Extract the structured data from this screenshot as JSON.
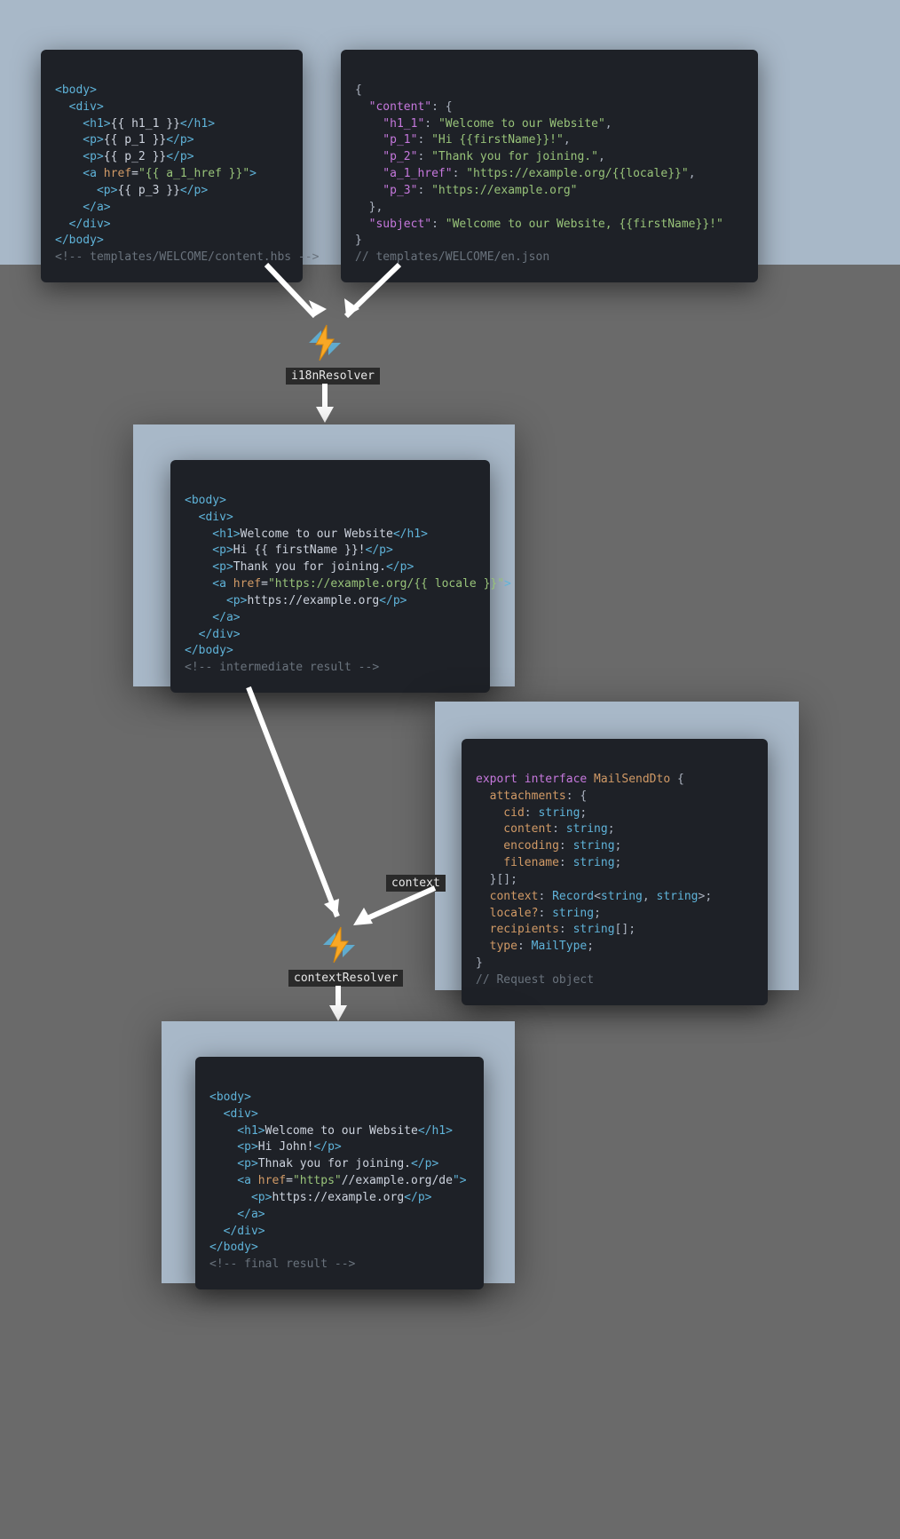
{
  "labels": {
    "i18nResolver": "i18nResolver",
    "contextResolver": "contextResolver",
    "context": "context"
  },
  "code": {
    "box1": {
      "l1a": "<body>",
      "l2a": "  <div>",
      "l3a": "    <h1>",
      "l3b": "{{ h1_1 }}",
      "l3c": "</h1>",
      "l4a": "    <p>",
      "l4b": "{{ p_1 }}",
      "l4c": "</p>",
      "l5a": "    <p>",
      "l5b": "{{ p_2 }}",
      "l5c": "</p>",
      "l6a": "    <a ",
      "l6b": "href",
      "l6c": "=",
      "l6d": "\"{{ a_1_href }}\"",
      "l6e": ">",
      "l7a": "      <p>",
      "l7b": "{{ p_3 }}",
      "l7c": "</p>",
      "l8a": "    </a>",
      "l9a": "  </div>",
      "l10a": "</body>",
      "l11a": "<!-- templates/WELCOME/content.hbs -->"
    },
    "box2": {
      "l1": "{",
      "l2a": "  \"content\"",
      "l2b": ": {",
      "l3a": "    \"h1_1\"",
      "l3b": ": ",
      "l3c": "\"Welcome to our Website\"",
      "l3d": ",",
      "l4a": "    \"p_1\"",
      "l4b": ": ",
      "l4c": "\"Hi {{firstName}}!\"",
      "l4d": ",",
      "l5a": "    \"p_2\"",
      "l5b": ": ",
      "l5c": "\"Thank you for joining.\"",
      "l5d": ",",
      "l6a": "    \"a_1_href\"",
      "l6b": ": ",
      "l6c": "\"https://example.org/{{locale}}\"",
      "l6d": ",",
      "l7a": "    \"p_3\"",
      "l7b": ": ",
      "l7c": "\"https://example.org\"",
      "l8": "  },",
      "l9a": "  \"subject\"",
      "l9b": ": ",
      "l9c": "\"Welcome to our Website, {{firstName}}!\"",
      "l10": "}",
      "l11": "// templates/WELCOME/en.json"
    },
    "box3": {
      "l1": "<body>",
      "l2": "  <div>",
      "l3a": "    <h1>",
      "l3b": "Welcome to our Website",
      "l3c": "</h1>",
      "l4a": "    <p>",
      "l4b": "Hi {{ firstName }}!",
      "l4c": "</p>",
      "l5a": "    <p>",
      "l5b": "Thank you for joining.",
      "l5c": "</p>",
      "l6a": "    <a ",
      "l6b": "href",
      "l6c": "=",
      "l6d": "\"https://example.org/{{ locale }}\"",
      "l6e": ">",
      "l7a": "      <p>",
      "l7b": "https://example.org",
      "l7c": "</p>",
      "l8": "    </a>",
      "l9": "  </div>",
      "l10": "</body>",
      "l11": "<!-- intermediate result -->"
    },
    "box4": {
      "l1a": "export interface",
      "l1b": " MailSendDto ",
      "l1c": "{",
      "l2a": "  attachments",
      "l2b": ": {",
      "l3a": "    cid",
      "l3b": ": ",
      "l3c": "string",
      "l3d": ";",
      "l4a": "    content",
      "l4b": ": ",
      "l4c": "string",
      "l4d": ";",
      "l5a": "    encoding",
      "l5b": ": ",
      "l5c": "string",
      "l5d": ";",
      "l6a": "    filename",
      "l6b": ": ",
      "l6c": "string",
      "l6d": ";",
      "l7": "  }[];",
      "l8a": "  context",
      "l8b": ": ",
      "l8c": "Record",
      "l8d": "<",
      "l8e": "string",
      "l8f": ", ",
      "l8g": "string",
      "l8h": ">;",
      "l9a": "  locale?",
      "l9b": ": ",
      "l9c": "string",
      "l9d": ";",
      "l10a": "  recipients",
      "l10b": ": ",
      "l10c": "string",
      "l10d": "[];",
      "l11a": "  type",
      "l11b": ": ",
      "l11c": "MailType",
      "l11d": ";",
      "l12": "}",
      "l13": "// Request object"
    },
    "box5": {
      "l1": "<body>",
      "l2": "  <div>",
      "l3a": "    <h1>",
      "l3b": "Welcome to our Website",
      "l3c": "</h1>",
      "l4a": "    <p>",
      "l4b": "Hi John!",
      "l4c": "</p>",
      "l5a": "    <p>",
      "l5b": "Thnak you for joining.",
      "l5c": "</p>",
      "l6a": "    <a ",
      "l6b": "href",
      "l6c": "=",
      "l6d": "\"https\"",
      "l6e": "//example.org/de",
      "l6f": "\">",
      "l7a": "      <p>",
      "l7b": "https://example.org",
      "l7c": "</p>",
      "l8": "    </a>",
      "l9": "  </div>",
      "l10": "</body>",
      "l11": "<!-- final result -->"
    }
  }
}
